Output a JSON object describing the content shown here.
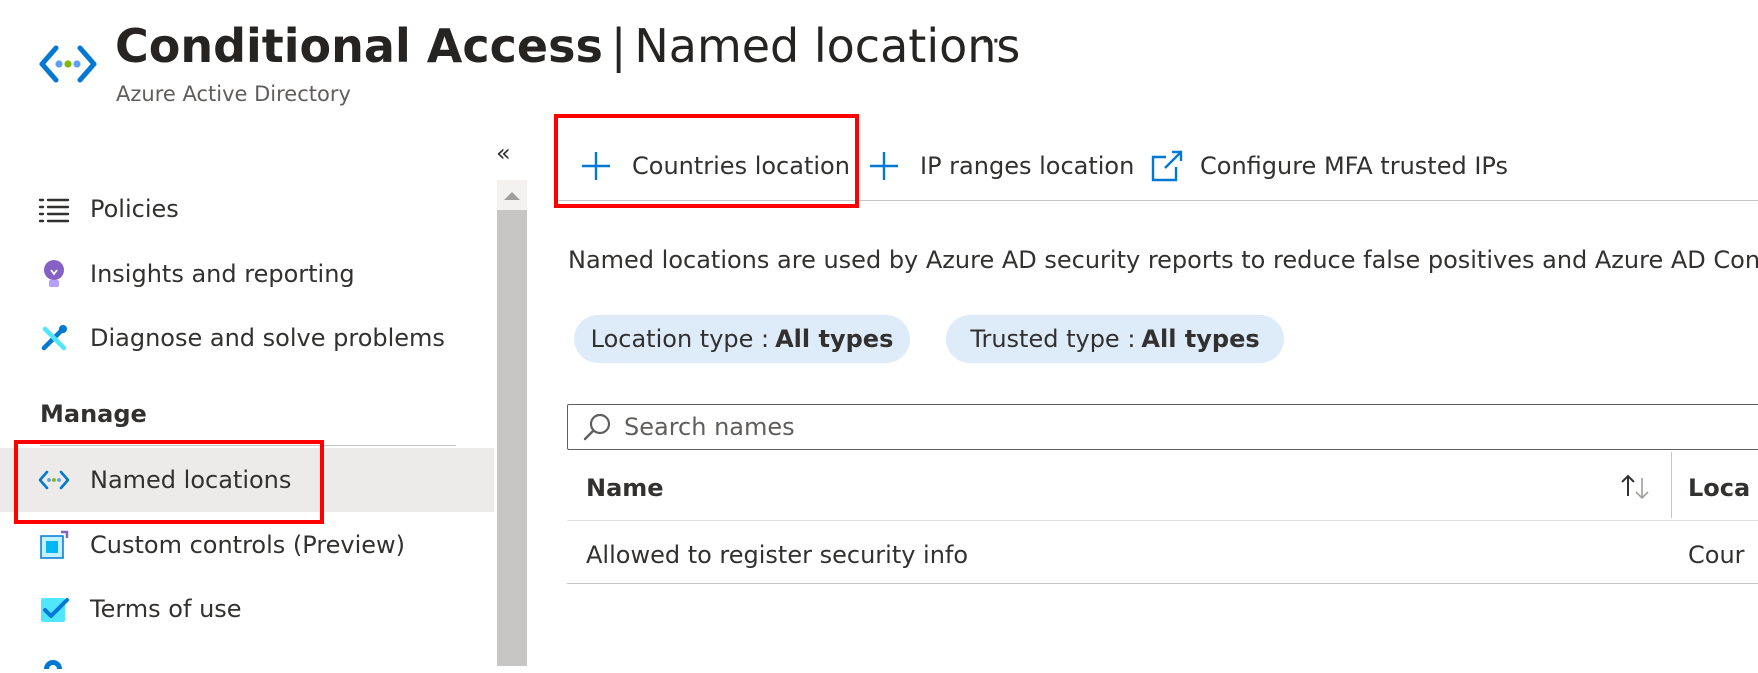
{
  "header": {
    "title": "Conditional Access",
    "separator": "|",
    "section": "Named locations",
    "more_label": "···",
    "subtitle": "Azure Active Directory",
    "icon": "named-locations-icon"
  },
  "sidebar": {
    "collapse_label": "«",
    "items": [
      {
        "label": "Policies",
        "icon": "list-icon"
      },
      {
        "label": "Insights and reporting",
        "icon": "lightbulb-icon"
      },
      {
        "label": "Diagnose and solve problems",
        "icon": "wrench-icon"
      }
    ],
    "section_heading": "Manage",
    "manage_items": [
      {
        "label": "Named locations",
        "icon": "named-locations-icon",
        "selected": true
      },
      {
        "label": "Custom controls (Preview)",
        "icon": "custom-controls-icon"
      },
      {
        "label": "Terms of use",
        "icon": "terms-check-icon"
      }
    ]
  },
  "toolbar": {
    "countries_location": "Countries location",
    "ip_ranges_location": "IP ranges location",
    "configure_mfa": "Configure MFA trusted IPs"
  },
  "description": "Named locations are used by Azure AD security reports to reduce false positives and Azure AD Conditio",
  "filters": {
    "location_type": {
      "label": "Location type :",
      "value": "All types"
    },
    "trusted_type": {
      "label": "Trusted type :",
      "value": "All types"
    }
  },
  "search": {
    "placeholder": "Search names",
    "value": ""
  },
  "table": {
    "columns": [
      "Name",
      "Loca"
    ],
    "rows": [
      {
        "name": "Allowed to register security info",
        "location_type": "Cour"
      }
    ]
  },
  "colors": {
    "accent": "#0078d4",
    "highlight_box": "#ff0000",
    "pill_bg": "#deecf9",
    "selected_bg": "#edebe9"
  }
}
